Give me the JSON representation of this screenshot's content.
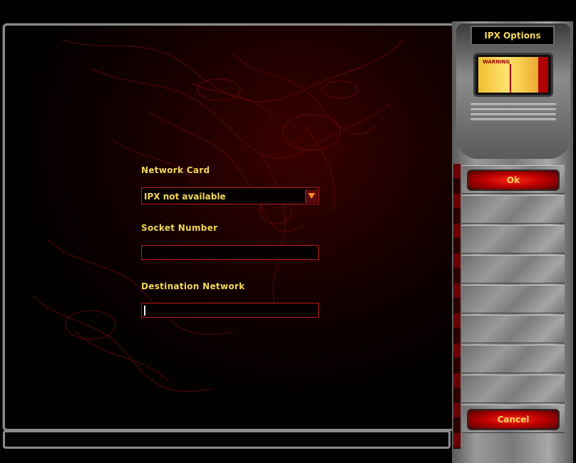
{
  "dialog": {
    "title": "IPX Options"
  },
  "monitor": {
    "warning_text": "WARNING"
  },
  "form": {
    "network_card": {
      "label": "Network Card",
      "value": "IPX not available"
    },
    "socket_number": {
      "label": "Socket Number",
      "value": ""
    },
    "destination_network": {
      "label": "Destination Network",
      "value": ""
    }
  },
  "buttons": {
    "ok": "Ok",
    "cancel": "Cancel"
  },
  "colors": {
    "label": "#f2d75a",
    "border": "#c01818",
    "button": "#c00000"
  },
  "icons": {
    "dropdown": "triangle-down-icon"
  }
}
